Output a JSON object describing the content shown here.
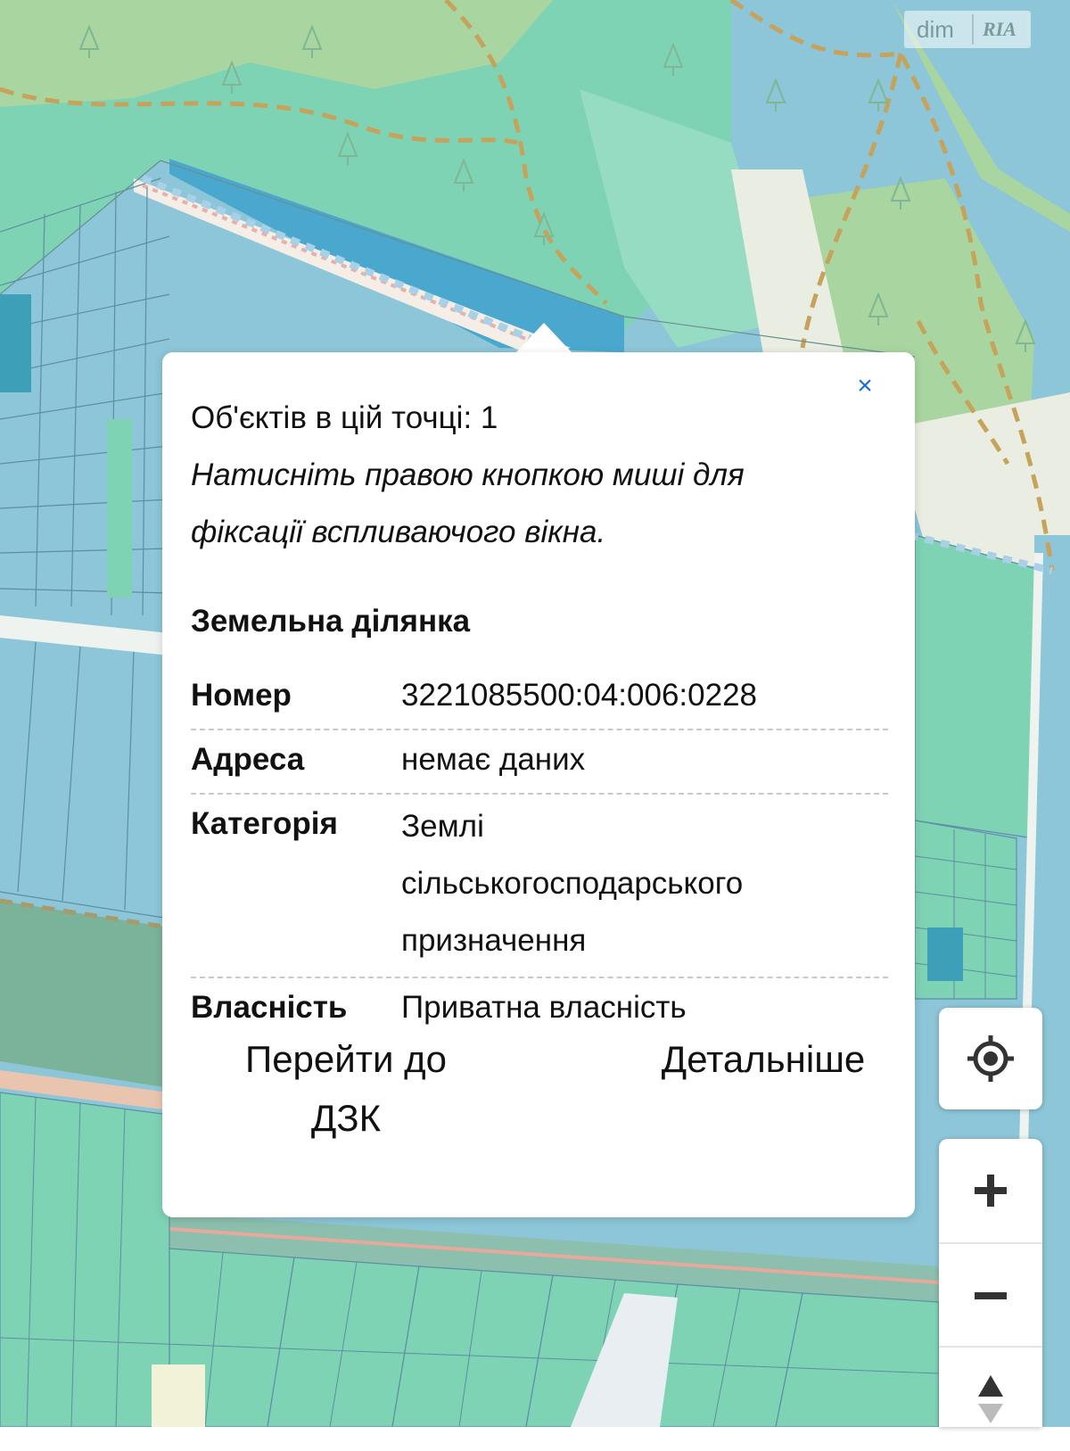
{
  "watermark": {
    "left": "dim",
    "right": "RIA"
  },
  "popup": {
    "count_text": "Об'єктів в цій точці: 1",
    "hint_line1": "Натисніть правою кнопкою миші для",
    "hint_line2": "фіксації вспливаючого вікна.",
    "section_title": "Земельна ділянка",
    "close_symbol": "×",
    "properties": [
      {
        "key": "Номер",
        "value": "3221085500:04:006:0228"
      },
      {
        "key": "Адреса",
        "value": "немає даних"
      },
      {
        "key": "Категорія",
        "value_line1": "Землі",
        "value_line2": "сільськогосподарського",
        "value_line3": "призначення"
      },
      {
        "key": "Власність",
        "value": "Приватна власність"
      }
    ],
    "actions": {
      "dzk_line1": "Перейти до",
      "dzk_line2": "ДЗК",
      "details": "Детальніше"
    }
  },
  "controls": {
    "locate_icon": "crosshair-icon",
    "zoom_in_icon": "plus-icon",
    "zoom_out_icon": "minus-icon",
    "tilt_icon": "triangle-up-icon"
  },
  "colors": {
    "close_accent": "#1a6fd1",
    "forest": "#a9d6a0",
    "parcel_green": "#7fd3b5",
    "parcel_blue": "#8cc6d8"
  }
}
